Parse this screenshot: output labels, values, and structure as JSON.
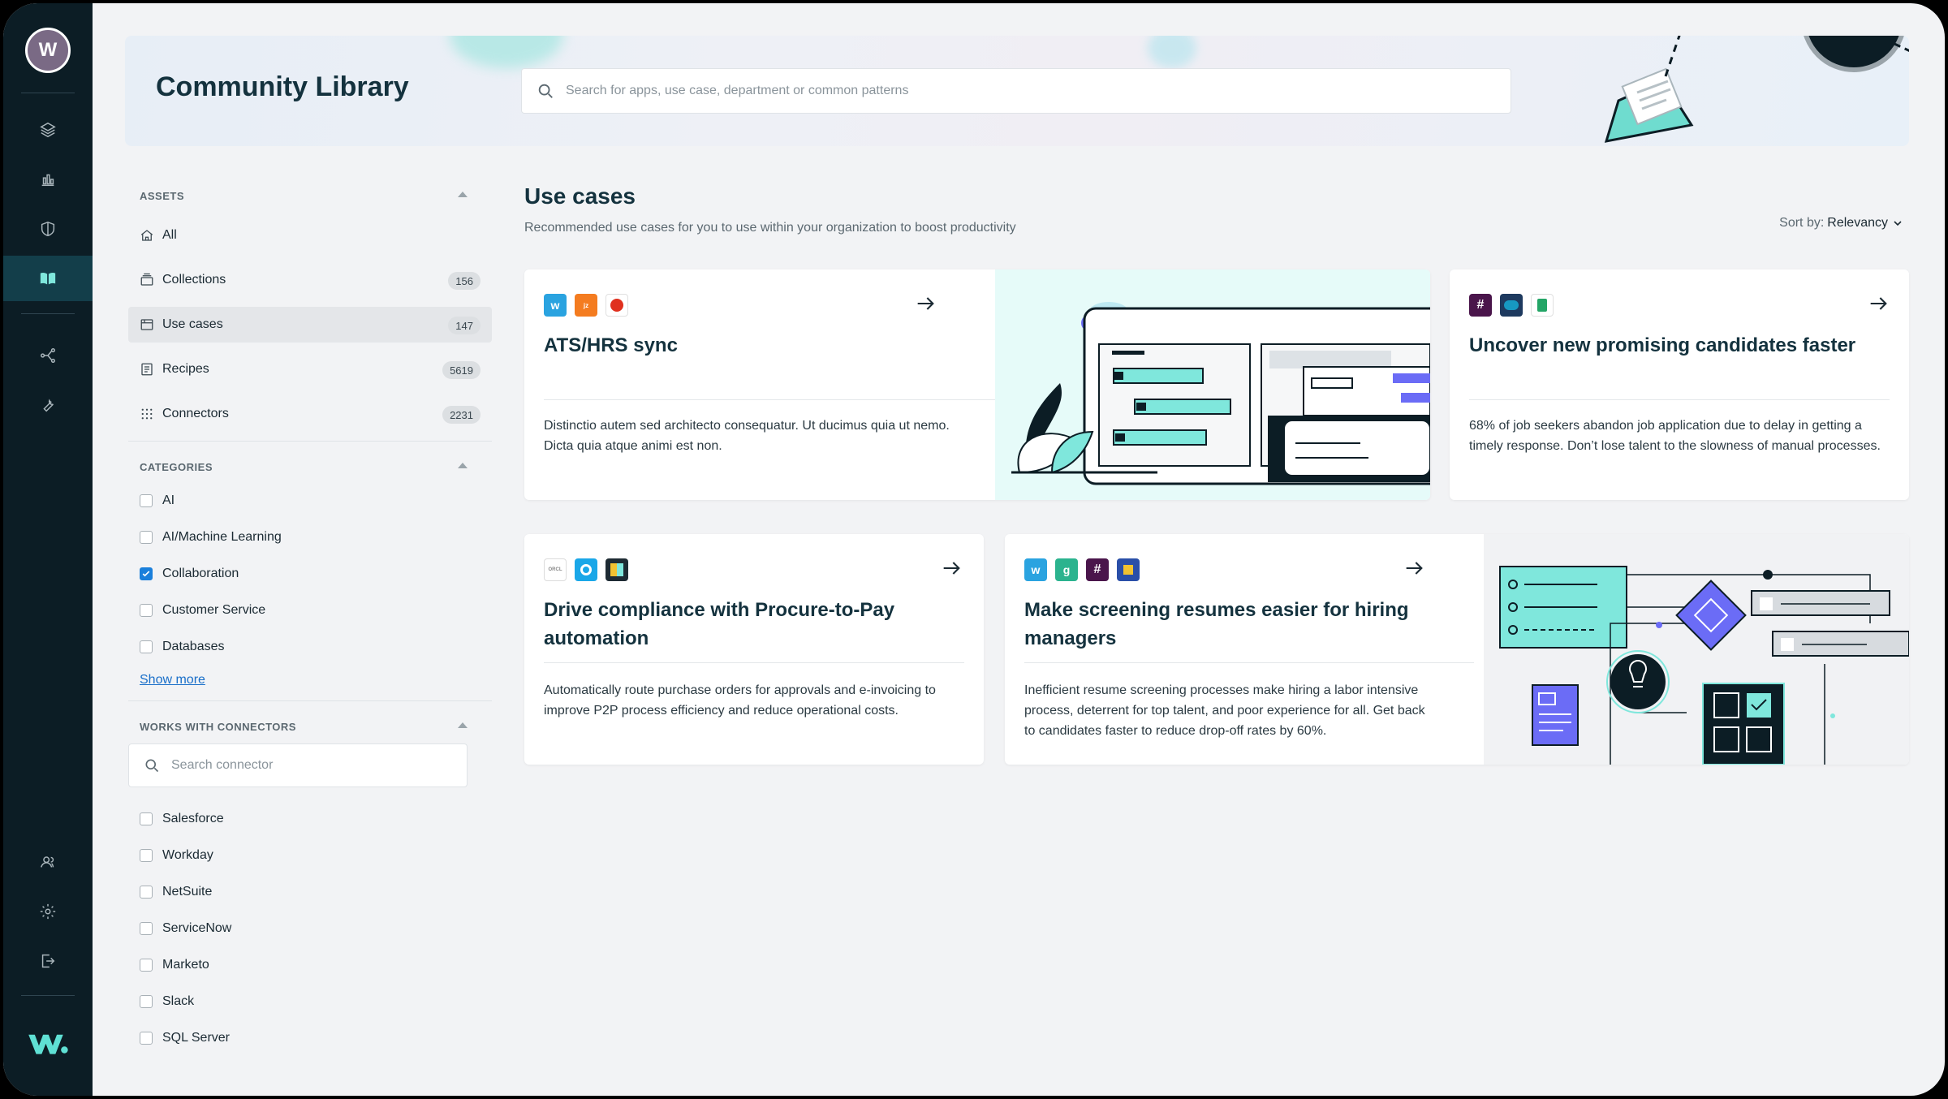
{
  "user": {
    "avatar_initial": "W"
  },
  "header": {
    "title": "Community Library",
    "search_placeholder": "Search for apps, use case, department or common patterns"
  },
  "filters": {
    "assets": {
      "heading": "ASSETS",
      "items": [
        {
          "label": "All",
          "count": "",
          "icon": "home-icon"
        },
        {
          "label": "Collections",
          "count": "156",
          "icon": "collection-icon"
        },
        {
          "label": "Use cases",
          "count": "147",
          "icon": "use-case-icon",
          "active": true
        },
        {
          "label": "Recipes",
          "count": "5619",
          "icon": "recipe-icon"
        },
        {
          "label": "Connectors",
          "count": "2231",
          "icon": "grid-icon"
        }
      ]
    },
    "categories": {
      "heading": "CATEGORIES",
      "items": [
        {
          "label": "AI",
          "checked": false
        },
        {
          "label": "AI/Machine Learning",
          "checked": false
        },
        {
          "label": "Collaboration",
          "checked": true
        },
        {
          "label": "Customer Service",
          "checked": false
        },
        {
          "label": "Databases",
          "checked": false
        }
      ],
      "show_more": "Show more"
    },
    "connectors": {
      "heading": "WORKS WITH CONNECTORS",
      "search_placeholder": "Search connector",
      "items": [
        {
          "label": "Salesforce",
          "checked": false
        },
        {
          "label": "Workday",
          "checked": false
        },
        {
          "label": "NetSuite",
          "checked": false
        },
        {
          "label": "ServiceNow",
          "checked": false
        },
        {
          "label": "Marketo",
          "checked": false
        },
        {
          "label": "Slack",
          "checked": false
        },
        {
          "label": "SQL Server",
          "checked": false
        }
      ]
    }
  },
  "main": {
    "title": "Use cases",
    "subtitle": "Recommended use cases for you to use within your organization to boost productivity",
    "sort_label": "Sort by:",
    "sort_value": "Relevancy",
    "cards": [
      {
        "title": "ATS/HRS sync",
        "description": "Distinctio autem sed architecto consequatur. Ut ducimus quia ut nemo. Dicta quia atque animi est non."
      },
      {
        "title": "Uncover new promising candidates faster",
        "description": "68% of job seekers abandon job application due to delay in getting a timely response. Don’t lose talent to the slowness of manual processes."
      },
      {
        "title": "Drive compliance with Procure-to-Pay automation",
        "description": "Automatically route purchase orders for approvals and e-invoicing to improve P2P process efficiency and reduce operational costs."
      },
      {
        "title": "Make screening resumes easier for hiring managers",
        "description": "Inefficient resume screening processes make hiring a labor intensive process, deterrent for top talent, and poor experience for all. Get back to candidates faster to reduce drop-off rates by 60%."
      }
    ]
  },
  "colors": {
    "rail": "#0c1d25",
    "rail_active": "#133e4a",
    "accent_teal": "#7fe7dc",
    "brand_purple": "#7a6a85",
    "link": "#1a6fc9",
    "checkbox_on": "#1a7fdb"
  }
}
